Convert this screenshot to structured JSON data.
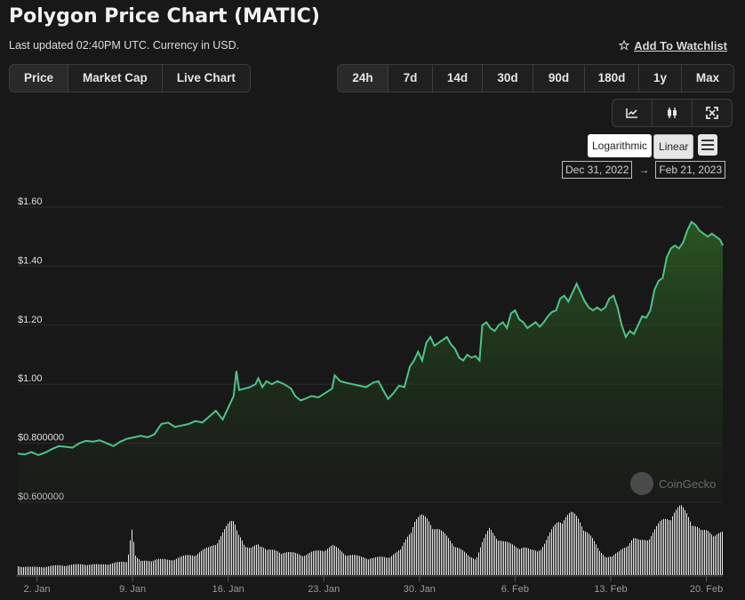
{
  "header": {
    "title": "Polygon Price Chart (MATIC)",
    "subtitle": "Last updated 02:40PM UTC. Currency in USD.",
    "watchlist_label": "Add To Watchlist"
  },
  "view_tabs": [
    "Price",
    "Market Cap",
    "Live Chart"
  ],
  "range_tabs": [
    "24h",
    "7d",
    "14d",
    "30d",
    "90d",
    "180d",
    "1y",
    "Max"
  ],
  "chart_type_buttons": [
    "line-chart-icon",
    "candlestick-icon",
    "fullscreen-icon"
  ],
  "scale": {
    "log_label": "Logarithmic",
    "linear_label": "Linear",
    "selected": "Linear"
  },
  "date_range": {
    "from": "Dec 31, 2022",
    "to": "Feb 21, 2023"
  },
  "watermark": "CoinGecko",
  "colors": {
    "line": "#4fc28a",
    "bg": "#181818",
    "volume": "#ffffff"
  },
  "chart_data": {
    "type": "area",
    "x_ticks": [
      "2. Jan",
      "9. Jan",
      "16. Jan",
      "23. Jan",
      "30. Jan",
      "6. Feb",
      "13. Feb",
      "20. Feb"
    ],
    "y_ticks": [
      "$1.60",
      "$1.40",
      "$1.20",
      "$1.00",
      "$0.800000",
      "$0.600000"
    ],
    "y_tick_values": [
      1.6,
      1.4,
      1.2,
      1.0,
      0.8,
      0.6
    ],
    "ylim": [
      0.6,
      1.6
    ],
    "x_domain_days": [
      0,
      51.6
    ],
    "x_tick_days": [
      1.4,
      8.4,
      15.4,
      22.4,
      29.4,
      36.4,
      43.4,
      50.4
    ],
    "series": [
      {
        "points": [
          [
            0.0,
            0.765
          ],
          [
            0.5,
            0.762
          ],
          [
            1.0,
            0.77
          ],
          [
            1.5,
            0.76
          ],
          [
            2.0,
            0.768
          ],
          [
            2.5,
            0.78
          ],
          [
            3.0,
            0.79
          ],
          [
            3.5,
            0.788
          ],
          [
            4.0,
            0.785
          ],
          [
            4.5,
            0.8
          ],
          [
            5.0,
            0.808
          ],
          [
            5.5,
            0.805
          ],
          [
            6.0,
            0.81
          ],
          [
            6.5,
            0.8
          ],
          [
            7.0,
            0.79
          ],
          [
            7.5,
            0.805
          ],
          [
            8.0,
            0.815
          ],
          [
            8.5,
            0.82
          ],
          [
            9.0,
            0.825
          ],
          [
            9.5,
            0.82
          ],
          [
            10.0,
            0.83
          ],
          [
            10.5,
            0.865
          ],
          [
            11.0,
            0.87
          ],
          [
            11.5,
            0.855
          ],
          [
            12.0,
            0.86
          ],
          [
            12.5,
            0.865
          ],
          [
            13.0,
            0.875
          ],
          [
            13.5,
            0.87
          ],
          [
            14.0,
            0.89
          ],
          [
            14.5,
            0.91
          ],
          [
            15.0,
            0.88
          ],
          [
            15.5,
            0.93
          ],
          [
            15.8,
            0.96
          ],
          [
            16.0,
            1.045
          ],
          [
            16.2,
            0.98
          ],
          [
            16.6,
            0.985
          ],
          [
            17.0,
            0.99
          ],
          [
            17.4,
            1.0
          ],
          [
            17.6,
            1.02
          ],
          [
            17.9,
            0.99
          ],
          [
            18.2,
            1.01
          ],
          [
            18.6,
            1.0
          ],
          [
            19.0,
            1.01
          ],
          [
            19.5,
            1.0
          ],
          [
            20.0,
            0.985
          ],
          [
            20.3,
            0.96
          ],
          [
            20.7,
            0.945
          ],
          [
            21.0,
            0.95
          ],
          [
            21.5,
            0.96
          ],
          [
            22.0,
            0.955
          ],
          [
            22.5,
            0.97
          ],
          [
            23.0,
            0.985
          ],
          [
            23.2,
            1.03
          ],
          [
            23.6,
            1.01
          ],
          [
            24.0,
            1.005
          ],
          [
            24.5,
            1.0
          ],
          [
            25.0,
            0.995
          ],
          [
            25.5,
            0.99
          ],
          [
            26.0,
            1.005
          ],
          [
            26.4,
            1.01
          ],
          [
            26.8,
            0.975
          ],
          [
            27.1,
            0.95
          ],
          [
            27.5,
            0.97
          ],
          [
            27.9,
            0.995
          ],
          [
            28.3,
            0.99
          ],
          [
            28.7,
            1.06
          ],
          [
            29.0,
            1.08
          ],
          [
            29.3,
            1.11
          ],
          [
            29.6,
            1.08
          ],
          [
            29.9,
            1.14
          ],
          [
            30.2,
            1.16
          ],
          [
            30.5,
            1.13
          ],
          [
            30.8,
            1.14
          ],
          [
            31.1,
            1.15
          ],
          [
            31.4,
            1.16
          ],
          [
            31.7,
            1.135
          ],
          [
            32.0,
            1.12
          ],
          [
            32.3,
            1.09
          ],
          [
            32.6,
            1.08
          ],
          [
            32.9,
            1.1
          ],
          [
            33.2,
            1.09
          ],
          [
            33.5,
            1.095
          ],
          [
            33.8,
            1.08
          ],
          [
            34.0,
            1.2
          ],
          [
            34.3,
            1.21
          ],
          [
            34.6,
            1.19
          ],
          [
            34.9,
            1.18
          ],
          [
            35.2,
            1.2
          ],
          [
            35.5,
            1.21
          ],
          [
            35.8,
            1.19
          ],
          [
            36.1,
            1.24
          ],
          [
            36.4,
            1.25
          ],
          [
            36.7,
            1.22
          ],
          [
            37.0,
            1.21
          ],
          [
            37.3,
            1.19
          ],
          [
            37.6,
            1.2
          ],
          [
            37.9,
            1.21
          ],
          [
            38.2,
            1.195
          ],
          [
            38.5,
            1.21
          ],
          [
            38.8,
            1.23
          ],
          [
            39.1,
            1.245
          ],
          [
            39.4,
            1.25
          ],
          [
            39.7,
            1.29
          ],
          [
            40.0,
            1.3
          ],
          [
            40.3,
            1.28
          ],
          [
            40.6,
            1.31
          ],
          [
            40.9,
            1.34
          ],
          [
            41.2,
            1.31
          ],
          [
            41.5,
            1.28
          ],
          [
            41.8,
            1.26
          ],
          [
            42.1,
            1.25
          ],
          [
            42.4,
            1.26
          ],
          [
            42.7,
            1.25
          ],
          [
            43.0,
            1.26
          ],
          [
            43.3,
            1.29
          ],
          [
            43.6,
            1.3
          ],
          [
            43.9,
            1.26
          ],
          [
            44.2,
            1.2
          ],
          [
            44.5,
            1.16
          ],
          [
            44.8,
            1.18
          ],
          [
            45.1,
            1.17
          ],
          [
            45.4,
            1.2
          ],
          [
            45.7,
            1.23
          ],
          [
            46.0,
            1.225
          ],
          [
            46.3,
            1.25
          ],
          [
            46.6,
            1.32
          ],
          [
            46.9,
            1.35
          ],
          [
            47.2,
            1.36
          ],
          [
            47.5,
            1.43
          ],
          [
            47.8,
            1.46
          ],
          [
            48.1,
            1.47
          ],
          [
            48.4,
            1.46
          ],
          [
            48.7,
            1.48
          ],
          [
            49.0,
            1.52
          ],
          [
            49.3,
            1.55
          ],
          [
            49.6,
            1.54
          ],
          [
            49.9,
            1.52
          ],
          [
            50.2,
            1.51
          ],
          [
            50.5,
            1.5
          ],
          [
            50.8,
            1.51
          ],
          [
            51.1,
            1.5
          ],
          [
            51.4,
            1.49
          ],
          [
            51.6,
            1.47
          ]
        ]
      }
    ],
    "volume_profile": [
      [
        0.0,
        0.15
      ],
      [
        1.0,
        0.13
      ],
      [
        2.0,
        0.14
      ],
      [
        3.0,
        0.16
      ],
      [
        4.0,
        0.17
      ],
      [
        5.0,
        0.18
      ],
      [
        6.0,
        0.17
      ],
      [
        7.0,
        0.2
      ],
      [
        8.0,
        0.22
      ],
      [
        8.3,
        0.85
      ],
      [
        8.6,
        0.3
      ],
      [
        9.0,
        0.22
      ],
      [
        10.0,
        0.26
      ],
      [
        11.0,
        0.25
      ],
      [
        12.0,
        0.3
      ],
      [
        13.0,
        0.35
      ],
      [
        14.0,
        0.45
      ],
      [
        14.5,
        0.55
      ],
      [
        15.0,
        0.7
      ],
      [
        15.5,
        0.85
      ],
      [
        15.8,
        0.9
      ],
      [
        16.2,
        0.7
      ],
      [
        16.6,
        0.45
      ],
      [
        17.0,
        0.42
      ],
      [
        17.6,
        0.55
      ],
      [
        18.2,
        0.4
      ],
      [
        19.0,
        0.4
      ],
      [
        20.0,
        0.36
      ],
      [
        21.0,
        0.34
      ],
      [
        22.0,
        0.4
      ],
      [
        23.0,
        0.48
      ],
      [
        24.0,
        0.35
      ],
      [
        25.0,
        0.3
      ],
      [
        26.0,
        0.28
      ],
      [
        27.0,
        0.3
      ],
      [
        28.0,
        0.4
      ],
      [
        28.5,
        0.65
      ],
      [
        29.0,
        0.9
      ],
      [
        29.5,
        0.95
      ],
      [
        30.0,
        0.92
      ],
      [
        30.5,
        0.8
      ],
      [
        31.0,
        0.7
      ],
      [
        31.5,
        0.6
      ],
      [
        32.0,
        0.5
      ],
      [
        32.5,
        0.4
      ],
      [
        33.0,
        0.3
      ],
      [
        33.5,
        0.28
      ],
      [
        34.0,
        0.55
      ],
      [
        34.5,
        0.75
      ],
      [
        35.0,
        0.65
      ],
      [
        35.5,
        0.55
      ],
      [
        36.0,
        0.5
      ],
      [
        36.5,
        0.48
      ],
      [
        37.0,
        0.46
      ],
      [
        37.5,
        0.4
      ],
      [
        38.0,
        0.4
      ],
      [
        38.5,
        0.52
      ],
      [
        39.0,
        0.7
      ],
      [
        39.5,
        0.88
      ],
      [
        40.0,
        0.98
      ],
      [
        40.5,
        1.0
      ],
      [
        41.0,
        0.92
      ],
      [
        41.5,
        0.78
      ],
      [
        42.0,
        0.6
      ],
      [
        42.5,
        0.4
      ],
      [
        43.0,
        0.32
      ],
      [
        43.5,
        0.3
      ],
      [
        44.0,
        0.38
      ],
      [
        44.5,
        0.5
      ],
      [
        45.0,
        0.6
      ],
      [
        45.5,
        0.55
      ],
      [
        46.0,
        0.6
      ],
      [
        46.5,
        0.72
      ],
      [
        47.0,
        0.85
      ],
      [
        47.5,
        0.95
      ],
      [
        48.0,
        1.05
      ],
      [
        48.5,
        1.1
      ],
      [
        49.0,
        1.0
      ],
      [
        49.5,
        0.85
      ],
      [
        50.0,
        0.7
      ],
      [
        50.5,
        0.72
      ],
      [
        51.0,
        0.7
      ],
      [
        51.6,
        0.68
      ]
    ]
  }
}
